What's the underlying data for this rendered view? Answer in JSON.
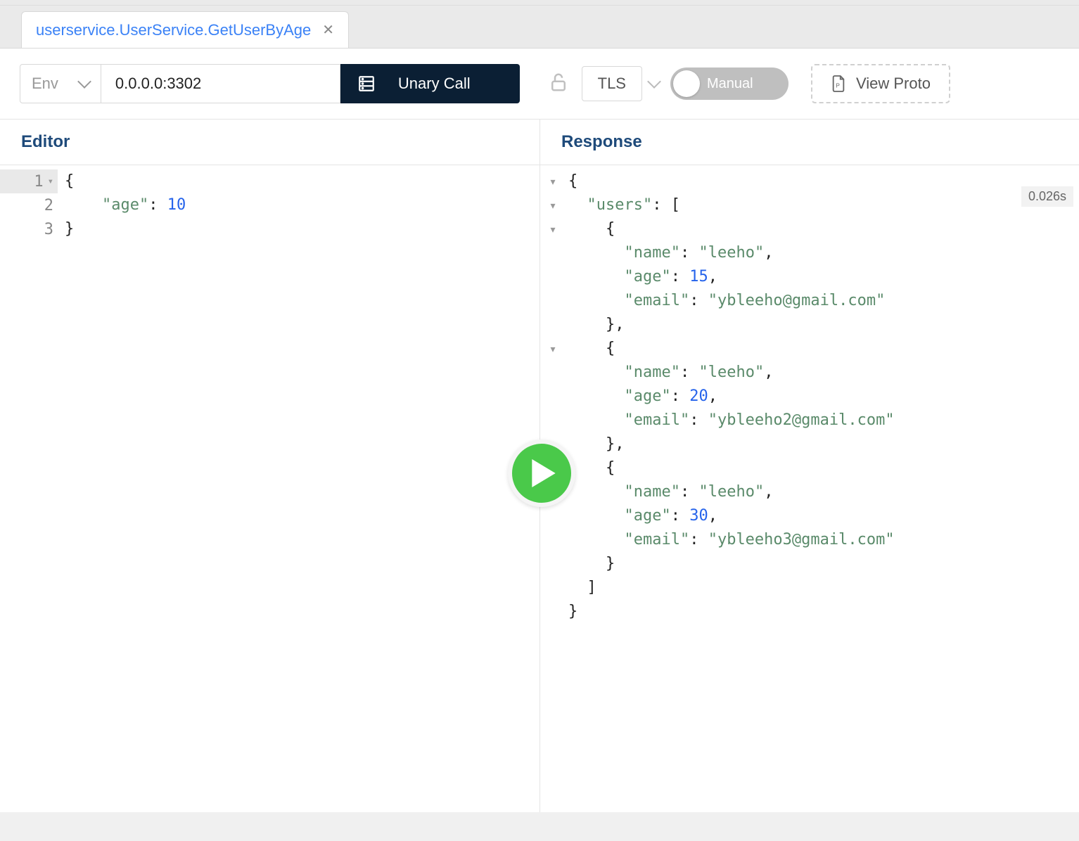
{
  "tab": {
    "title": "userservice.UserService.GetUserByAge"
  },
  "toolbar": {
    "env_placeholder": "Env",
    "address": "0.0.0.0:3302",
    "call_type": "Unary Call",
    "tls_label": "TLS",
    "toggle_label": "Manual",
    "view_proto_label": "View Proto"
  },
  "panels": {
    "editor_title": "Editor",
    "response_title": "Response"
  },
  "editor": {
    "line_numbers": [
      "1",
      "2",
      "3"
    ],
    "tokens": [
      [
        {
          "t": "{",
          "c": "punc"
        }
      ],
      [
        {
          "t": "    ",
          "c": "punc"
        },
        {
          "t": "\"age\"",
          "c": "key"
        },
        {
          "t": ": ",
          "c": "punc"
        },
        {
          "t": "10",
          "c": "num"
        }
      ],
      [
        {
          "t": "}",
          "c": "punc"
        }
      ]
    ]
  },
  "response": {
    "timing": "0.026s",
    "fold_rows": [
      0,
      1,
      2,
      7,
      12
    ],
    "tokens": [
      [
        {
          "t": "{",
          "c": "punc"
        }
      ],
      [
        {
          "t": "  ",
          "c": "punc"
        },
        {
          "t": "\"users\"",
          "c": "key"
        },
        {
          "t": ": [",
          "c": "punc"
        }
      ],
      [
        {
          "t": "    {",
          "c": "punc"
        }
      ],
      [
        {
          "t": "      ",
          "c": "punc"
        },
        {
          "t": "\"name\"",
          "c": "key"
        },
        {
          "t": ": ",
          "c": "punc"
        },
        {
          "t": "\"leeho\"",
          "c": "str"
        },
        {
          "t": ",",
          "c": "punc"
        }
      ],
      [
        {
          "t": "      ",
          "c": "punc"
        },
        {
          "t": "\"age\"",
          "c": "key"
        },
        {
          "t": ": ",
          "c": "punc"
        },
        {
          "t": "15",
          "c": "num"
        },
        {
          "t": ",",
          "c": "punc"
        }
      ],
      [
        {
          "t": "      ",
          "c": "punc"
        },
        {
          "t": "\"email\"",
          "c": "key"
        },
        {
          "t": ": ",
          "c": "punc"
        },
        {
          "t": "\"ybleeho@gmail.com\"",
          "c": "str"
        }
      ],
      [
        {
          "t": "    },",
          "c": "punc"
        }
      ],
      [
        {
          "t": "    {",
          "c": "punc"
        }
      ],
      [
        {
          "t": "      ",
          "c": "punc"
        },
        {
          "t": "\"name\"",
          "c": "key"
        },
        {
          "t": ": ",
          "c": "punc"
        },
        {
          "t": "\"leeho\"",
          "c": "str"
        },
        {
          "t": ",",
          "c": "punc"
        }
      ],
      [
        {
          "t": "      ",
          "c": "punc"
        },
        {
          "t": "\"age\"",
          "c": "key"
        },
        {
          "t": ": ",
          "c": "punc"
        },
        {
          "t": "20",
          "c": "num"
        },
        {
          "t": ",",
          "c": "punc"
        }
      ],
      [
        {
          "t": "      ",
          "c": "punc"
        },
        {
          "t": "\"email\"",
          "c": "key"
        },
        {
          "t": ": ",
          "c": "punc"
        },
        {
          "t": "\"ybleeho2@gmail.com\"",
          "c": "str"
        }
      ],
      [
        {
          "t": "    },",
          "c": "punc"
        }
      ],
      [
        {
          "t": "    {",
          "c": "punc"
        }
      ],
      [
        {
          "t": "      ",
          "c": "punc"
        },
        {
          "t": "\"name\"",
          "c": "key"
        },
        {
          "t": ": ",
          "c": "punc"
        },
        {
          "t": "\"leeho\"",
          "c": "str"
        },
        {
          "t": ",",
          "c": "punc"
        }
      ],
      [
        {
          "t": "      ",
          "c": "punc"
        },
        {
          "t": "\"age\"",
          "c": "key"
        },
        {
          "t": ": ",
          "c": "punc"
        },
        {
          "t": "30",
          "c": "num"
        },
        {
          "t": ",",
          "c": "punc"
        }
      ],
      [
        {
          "t": "      ",
          "c": "punc"
        },
        {
          "t": "\"email\"",
          "c": "key"
        },
        {
          "t": ": ",
          "c": "punc"
        },
        {
          "t": "\"ybleeho3@gmail.com\"",
          "c": "str"
        }
      ],
      [
        {
          "t": "    }",
          "c": "punc"
        }
      ],
      [
        {
          "t": "  ]",
          "c": "punc"
        }
      ],
      [
        {
          "t": "}",
          "c": "punc"
        }
      ]
    ]
  }
}
